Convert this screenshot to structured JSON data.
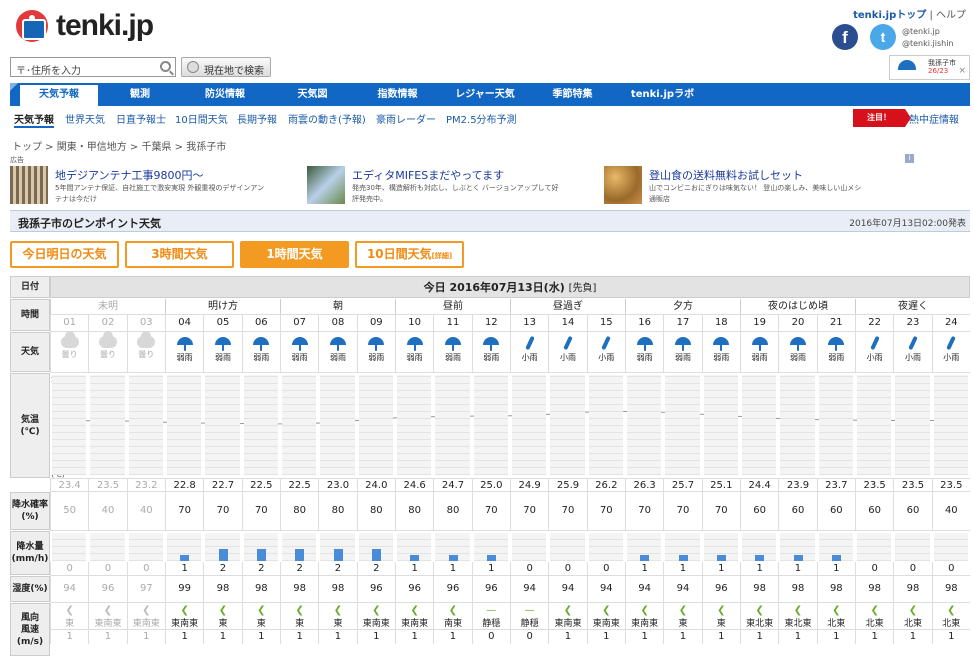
{
  "site": {
    "name": "tenki.jp",
    "toplink": "tenki.jpトップ",
    "help": "ヘルプ",
    "twitter_names": [
      "@tenki.jp",
      "@tenki.jishin"
    ]
  },
  "search": {
    "placeholder": "〒･住所を入力",
    "gps_button": "現在地で検索"
  },
  "fav": {
    "name": "我孫子市",
    "temps": "26/23"
  },
  "nav": [
    "天気予報",
    "観測",
    "防災情報",
    "天気図",
    "指数情報",
    "レジャー天気",
    "季節特集",
    "tenki.jpラボ"
  ],
  "subnav": [
    "天気予報",
    "世界天気",
    "日直予報士",
    "10日間天気",
    "長期予報",
    "雨雲の動き(予報)",
    "豪雨レーダー",
    "PM2.5分布予測"
  ],
  "notice": {
    "badge": "注目！",
    "text": "熱中症情報"
  },
  "breadcrumb": "トップ > 関東・甲信地方 > 千葉県 > 我孫子市",
  "ads": {
    "label": "広告",
    "items": [
      {
        "title": "地デジアンテナ工事9800円〜",
        "desc1": "5年間アンテナ保証、自社施工で激安実現 外観重視のデザインアン",
        "desc2": "テナは今だけ"
      },
      {
        "title": "エディタMIFESまだやってます",
        "desc1": "発売30年、構造解析も対応し、しぶとく バージョンアップして好",
        "desc2": "評発売中。"
      },
      {
        "title": "登山食の送料無料お試しセット",
        "desc1": "山でコンビニおにぎりは味気ない！ 登山の楽しみ、美味しい山メシ",
        "desc2": "通販店"
      }
    ]
  },
  "title": {
    "text": "我孫子市のピンポイント天気",
    "issued": "2016年07月13日02:00発表"
  },
  "tabs": [
    {
      "label": "今日明日の天気"
    },
    {
      "label": "3時間天気"
    },
    {
      "label": "1時間天気"
    },
    {
      "label": "10日間天気",
      "sub": "[詳細]"
    }
  ],
  "table": {
    "labels": {
      "date": "日付",
      "hour": "時間",
      "weather": "天気",
      "temp": "気温",
      "temp_unit": "(℃)",
      "precip_prob": "降水確率",
      "precip_prob_unit": "(%)",
      "precip": "降水量",
      "precip_unit": "(mm/h)",
      "humidity": "湿度(%)",
      "wind_dir": "風向",
      "wind_speed": "風速",
      "wind_unit": "(m/s)"
    },
    "date_heading": "今日 2016年07月13日(水)",
    "rokuyo": "[先負]",
    "chart_axis": {
      "title": "気温",
      "ticks": [
        "35",
        "30",
        "25",
        "20",
        "15",
        "10"
      ],
      "unit": "(℃)"
    },
    "periods": [
      {
        "label": "未明",
        "span": 3,
        "past": true
      },
      {
        "label": "明け方",
        "span": 3
      },
      {
        "label": "朝",
        "span": 3
      },
      {
        "label": "昼前",
        "span": 3
      },
      {
        "label": "昼過ぎ",
        "span": 3
      },
      {
        "label": "夕方",
        "span": 3
      },
      {
        "label": "夜のはじめ頃",
        "span": 3
      },
      {
        "label": "夜遅く",
        "span": 3
      }
    ],
    "hours": [
      "01",
      "02",
      "03",
      "04",
      "05",
      "06",
      "07",
      "08",
      "09",
      "10",
      "11",
      "12",
      "13",
      "14",
      "15",
      "16",
      "17",
      "18",
      "19",
      "20",
      "21",
      "22",
      "23",
      "24"
    ],
    "weather": [
      "曇り",
      "曇り",
      "曇り",
      "弱雨",
      "弱雨",
      "弱雨",
      "弱雨",
      "弱雨",
      "弱雨",
      "弱雨",
      "弱雨",
      "弱雨",
      "小雨",
      "小雨",
      "小雨",
      "弱雨",
      "弱雨",
      "弱雨",
      "弱雨",
      "弱雨",
      "弱雨",
      "小雨",
      "小雨",
      "小雨"
    ],
    "temperature": [
      23.4,
      23.5,
      23.2,
      22.8,
      22.7,
      22.5,
      22.5,
      23.0,
      24.0,
      24.6,
      24.7,
      25.0,
      24.9,
      25.9,
      26.2,
      26.3,
      25.7,
      25.1,
      24.4,
      23.9,
      23.7,
      23.5,
      23.5,
      23.5
    ],
    "precip_prob": [
      50,
      40,
      40,
      70,
      70,
      70,
      80,
      80,
      80,
      80,
      80,
      70,
      70,
      70,
      70,
      70,
      70,
      70,
      60,
      60,
      60,
      60,
      60,
      40
    ],
    "precip": [
      0,
      0,
      0,
      1,
      2,
      2,
      2,
      2,
      2,
      1,
      1,
      1,
      0,
      0,
      0,
      1,
      1,
      1,
      1,
      1,
      1,
      0,
      0,
      0
    ],
    "humidity": [
      94,
      96,
      97,
      99,
      98,
      98,
      98,
      98,
      96,
      96,
      96,
      96,
      94,
      94,
      94,
      94,
      94,
      96,
      98,
      98,
      98,
      98,
      98,
      98
    ],
    "wind_dir": [
      "東",
      "東南東",
      "東南東",
      "東南東",
      "東",
      "東",
      "東",
      "東",
      "東南東",
      "東南東",
      "南東",
      "静穏",
      "静穏",
      "東南東",
      "東南東",
      "東南東",
      "東",
      "東",
      "東北東",
      "東北東",
      "北東",
      "北東",
      "北東",
      "北東"
    ],
    "wind_speed": [
      1,
      1,
      1,
      1,
      1,
      1,
      1,
      1,
      1,
      1,
      1,
      0,
      0,
      1,
      1,
      1,
      1,
      1,
      1,
      1,
      1,
      1,
      1,
      1
    ],
    "past_count": 3
  }
}
